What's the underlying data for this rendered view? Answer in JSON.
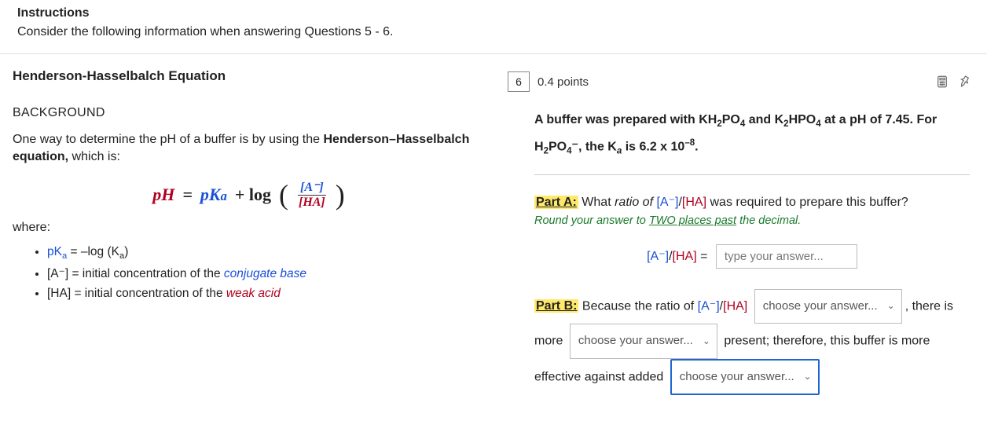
{
  "instructions": {
    "title": "Instructions",
    "text": "Consider the following information when answering Questions 5 - 6."
  },
  "left": {
    "title": "Henderson-Hasselbalch Equation",
    "background_label": "BACKGROUND",
    "intro_a": "One way to determine the pH of a buffer is by using the ",
    "intro_bold": "Henderson–Hasselbalch equation,",
    "intro_b": " which is:",
    "eq": {
      "pH": "pH",
      "eq_sign": " = ",
      "pKa_p": "p",
      "pKa_K": "K",
      "pKa_a": "a",
      "plus_log": " + log",
      "num": "[A⁻]",
      "den": "[HA]"
    },
    "where": "where:",
    "bullet1_a": "pK",
    "bullet1_sub": "a",
    "bullet1_b": " = –log (K",
    "bullet1_sub2": "a",
    "bullet1_c": ")",
    "bullet2_a": "[A⁻] = initial concentration of the ",
    "bullet2_b": "conjugate base",
    "bullet3_a": "[HA] = initial concentration of the ",
    "bullet3_b": "weak acid"
  },
  "right": {
    "q_number": "6",
    "points": "0.4 points",
    "prompt1_a": "A buffer was prepared with KH",
    "prompt1_b": "PO",
    "prompt1_c": " and K",
    "prompt1_d": "HPO",
    "prompt1_e": " at a pH of 7.45. For",
    "prompt2_a": "H",
    "prompt2_b": "PO",
    "prompt2_c": "⁻, the K",
    "prompt2_d": " is 6.2 x 10",
    "prompt2_e": ".",
    "partA_label": "Part A:",
    "partA_a": " What ",
    "partA_ratio": "ratio of ",
    "partA_b": "[A⁻]",
    "partA_slash": "/",
    "partA_c": "[HA]",
    "partA_d": " was required to prepare this buffer?",
    "hint_a": "Round your answer to ",
    "hint_b": "TWO places past",
    "hint_c": " the decimal.",
    "ratio_lhs_a": "[A⁻]",
    "ratio_lhs_slash": "/",
    "ratio_lhs_b": "[HA]",
    "ratio_eq": " = ",
    "input_placeholder": "type your answer...",
    "partB_label": "Part B:",
    "partB_a": " Because the ratio of ",
    "partB_b": "[A⁻]",
    "partB_c": "[HA]",
    "dropdown_placeholder": "choose your answer...",
    "partB_d": ", there is",
    "partB_e": "more",
    "partB_f": "present; therefore, this buffer is more",
    "partB_g": "effective against added"
  }
}
